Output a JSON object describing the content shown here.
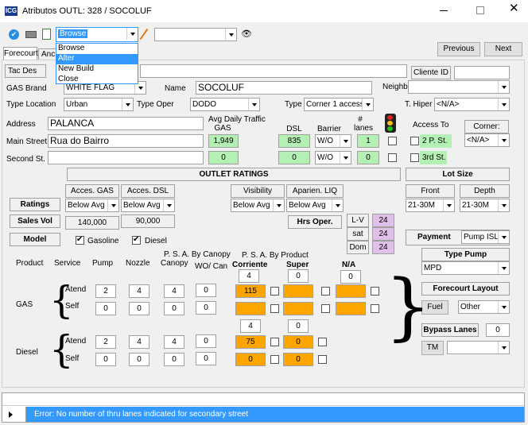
{
  "window": {
    "title": "Atributos OUTL: 328 / SOCOLUF",
    "logo": "ICG",
    "icons": {
      "min": "minimize-icon",
      "max": "maximize-icon",
      "close": "close-icon"
    }
  },
  "toolbar": {
    "mode_value": "Browse",
    "mode_options": [
      "Browse",
      "Alter",
      "New Build",
      "Close"
    ],
    "highlighted_option": "Alter"
  },
  "tabs": {
    "forecourt": "Forecourt",
    "anc": "Anc"
  },
  "nav": {
    "previous": "Previous",
    "next": "Next"
  },
  "labels": {
    "tac_des": "Tac Des",
    "cliente_id": "Cliente ID",
    "gas_brand": "GAS Brand",
    "name": "Name",
    "neighb": "Neighb",
    "type_location": "Type Location",
    "type_oper": "Type Oper",
    "type": "Type",
    "t_hiper": "T. Hiper",
    "address": "Address",
    "avg_daily": "Avg Daily Traffic",
    "gas": "GAS",
    "dsl": "DSL",
    "barrier": "Barrier",
    "lanes_hash": "#",
    "lanes": "lanes",
    "access_to": "Access To",
    "corner": "Corner:",
    "main_street": "Main Street",
    "second_st": "Second St.",
    "two_p_st": "2  P. St.",
    "third_st": "3rd St.",
    "outlet_ratings": "OUTLET RATINGS",
    "lot_size": "Lot Size",
    "acces_gas": "Acces. GAS",
    "acces_dsl": "Acces. DSL",
    "visibility": "Visibility",
    "aparien_liq": "Aparien. LIQ",
    "front": "Front",
    "depth": "Depth",
    "ratings": "Ratings",
    "sales_vol": "Sales Vol",
    "hrs_oper": "Hrs Oper.",
    "model": "Model",
    "gasoline": "Gasoline",
    "diesel_chk": "Diesel",
    "payment": "Payment",
    "type_pump": "Type Pump",
    "forecourt_layout": "Forecourt Layout",
    "fuel": "Fuel",
    "bypass_lanes": "Bypass Lanes",
    "tm": "TM",
    "product": "Product",
    "service": "Service",
    "pump": "Pump",
    "nozzle": "Nozzle",
    "canopy": "Canopy",
    "psa_canopy": "P. S. A. By Canopy",
    "wo_can": "WO/ Can",
    "psa_product": "P. S. A. By Product",
    "corriente": "Corriente",
    "super": "Super",
    "na": "N/A",
    "atend": "Atend",
    "self": "Self",
    "gas_row": "GAS",
    "diesel_row": "Diesel",
    "lv": "L-V",
    "sat": "sat",
    "dom": "Dom"
  },
  "values": {
    "gas_brand": "WHITE FLAG",
    "name": "SOCOLUF",
    "neighb": "",
    "type_location": "Urban",
    "type_oper": "DODO",
    "type": "Corner 1 access",
    "t_hiper": "<N/A>",
    "address": "PALANCA",
    "main_street": "Rua do Bairro",
    "second_st": "",
    "gas_main": "1,949",
    "dsl_main": "835",
    "barrier_main": "W/O",
    "lanes_main": "1",
    "gas_second": "0",
    "dsl_second": "0",
    "barrier_second": "W/O",
    "lanes_second": "0",
    "corner": "<N/A>",
    "acces_gas": "Below Avg",
    "acces_dsl": "Below Avg",
    "visibility": "Below Avg",
    "aparien_liq": "Below Avg",
    "front": "21-30M",
    "depth": "21-30M",
    "sales_gas": "140,000",
    "sales_dsl": "90,000",
    "hrs_lv": "24",
    "hrs_sat": "24",
    "hrs_dom": "24",
    "payment": "Pump ISL",
    "type_pump": "MPD",
    "fuel": "Other",
    "bypass": "0",
    "tm": ""
  },
  "grid": {
    "gas_top": {
      "corriente": "4",
      "super": "0",
      "na": "0"
    },
    "gas_atend": {
      "pump": "2",
      "nozzle": "4",
      "canopy": "4",
      "wo": "0",
      "corriente": "115",
      "super": "",
      "na": ""
    },
    "gas_self": {
      "pump": "0",
      "nozzle": "0",
      "canopy": "0",
      "wo": "0",
      "corriente": "",
      "super": "",
      "na": ""
    },
    "dsl_top": {
      "corriente": "4",
      "super": "0"
    },
    "dsl_atend": {
      "pump": "2",
      "nozzle": "4",
      "canopy": "4",
      "wo": "0",
      "corriente": "75",
      "super": "0"
    },
    "dsl_self": {
      "pump": "0",
      "nozzle": "0",
      "canopy": "0",
      "wo": "0",
      "corriente": "0",
      "super": "0"
    }
  },
  "status": {
    "message": "Error: No number of thru lanes indicated for secondary street"
  },
  "colors": {
    "accent": "#3399ff",
    "green": "#b4f0b4",
    "orange": "#ffa500",
    "pink": "#e0c0e8",
    "red": "#ff4a4a"
  }
}
